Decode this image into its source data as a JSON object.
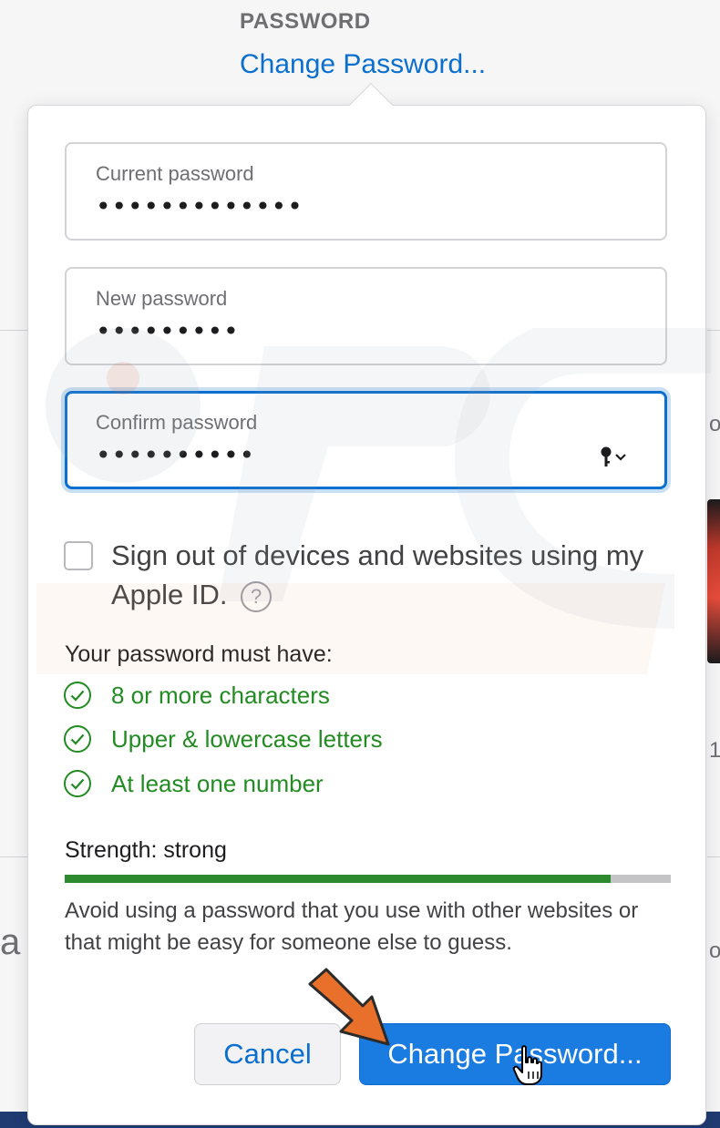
{
  "section": {
    "label": "PASSWORD",
    "link": "Change Password..."
  },
  "background": {
    "frag_left": "a",
    "frag_right_1": "ov",
    "frag_right_2": "o",
    "frag_right_3": "1"
  },
  "form": {
    "current_password": {
      "label": "Current password",
      "value": "•••••••••••••"
    },
    "new_password": {
      "label": "New password",
      "value": "•••••••••"
    },
    "confirm_password": {
      "label": "Confirm password",
      "value": "••••••••••"
    },
    "key_icon": "key-icon"
  },
  "signout": {
    "text": "Sign out of devices and websites using my Apple ID.",
    "help": "?",
    "checked": false
  },
  "requirements": {
    "title": "Your password must have:",
    "items": [
      {
        "label": "8 or more characters",
        "met": true
      },
      {
        "label": "Upper & lowercase letters",
        "met": true
      },
      {
        "label": "At least one number",
        "met": true
      }
    ]
  },
  "strength": {
    "label": "Strength: strong",
    "fraction": 0.9
  },
  "advice": "Avoid using a password that you use with other websites or that might be easy for someone else to guess.",
  "buttons": {
    "cancel": "Cancel",
    "change": "Change Password..."
  },
  "colors": {
    "accent": "#0a6fcf",
    "success": "#228b22",
    "strength_bar": "#2e8a2e",
    "annotation_arrow": "#e8702a"
  }
}
